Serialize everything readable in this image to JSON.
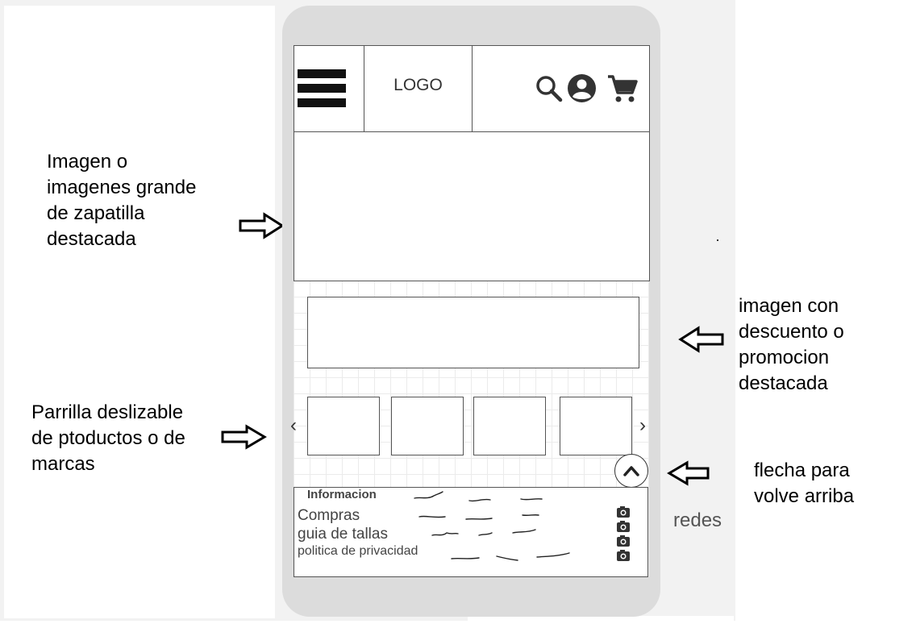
{
  "annotations": {
    "hero": "Imagen o\nimagenes grande\nde zapatilla\ndestacada",
    "promo": "imagen con\ndescuento o\npromocion\ndestacada",
    "carousel": "Parrilla deslizable\nde ptoductos o de\nmarcas",
    "back_to_top": "flecha para\nvolve arriba",
    "social": "redes"
  },
  "header": {
    "logo": "LOGO",
    "icons": [
      "menu-icon",
      "search-icon",
      "account-icon",
      "cart-icon"
    ]
  },
  "carousel": {
    "prev_label": "‹",
    "next_label": "›",
    "tile_count": 4
  },
  "footer": {
    "title": "Informacion",
    "items": [
      "Compras",
      "guia de tallas",
      "politica de privacidad"
    ],
    "social_icons": [
      "camera-icon",
      "camera-icon",
      "camera-icon",
      "camera-icon"
    ]
  }
}
